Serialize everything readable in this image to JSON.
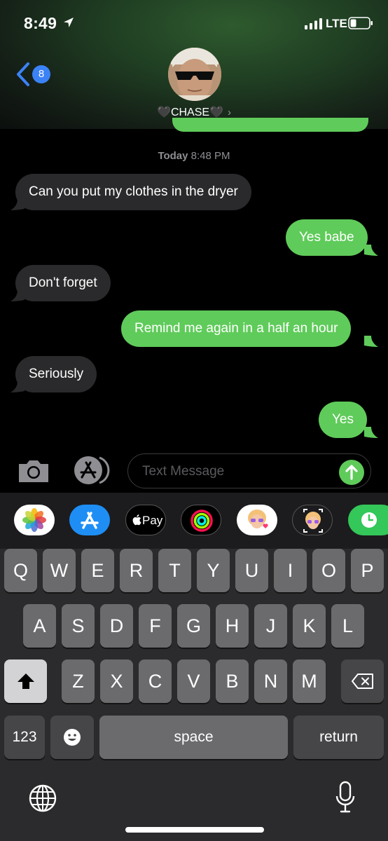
{
  "status_bar": {
    "time": "8:49",
    "network": "LTE"
  },
  "header": {
    "back_badge": "8",
    "contact_name": "🖤CHASE🖤",
    "chevron": "›"
  },
  "conversation": {
    "timestamp_day": "Today",
    "timestamp_time": "8:48 PM",
    "messages": [
      {
        "direction": "incoming",
        "text": "Can you put my clothes in the dryer"
      },
      {
        "direction": "outgoing",
        "text": "Yes babe"
      },
      {
        "direction": "incoming",
        "text": "Don't forget"
      },
      {
        "direction": "outgoing",
        "text": "Remind me again in a half an hour"
      },
      {
        "direction": "incoming",
        "text": "Seriously"
      },
      {
        "direction": "outgoing",
        "text": "Yes"
      }
    ]
  },
  "composer": {
    "placeholder": "Text Message"
  },
  "app_drawer": {
    "apple_pay_label": "Pay",
    "apps": [
      "photos-icon",
      "app-store-icon",
      "apple-pay-icon",
      "activity-icon",
      "memoji-stickers-icon",
      "animoji-icon",
      "screen-time-icon"
    ]
  },
  "keyboard": {
    "row1": [
      "Q",
      "W",
      "E",
      "R",
      "T",
      "Y",
      "U",
      "I",
      "O",
      "P"
    ],
    "row2": [
      "A",
      "S",
      "D",
      "F",
      "G",
      "H",
      "J",
      "K",
      "L"
    ],
    "row3": [
      "Z",
      "X",
      "C",
      "V",
      "B",
      "N",
      "M"
    ],
    "numbers_label": "123",
    "space_label": "space",
    "return_label": "return"
  },
  "colors": {
    "outgoing": "#5fcb5a",
    "incoming": "#2a2a2c",
    "badge": "#3b82f6"
  }
}
